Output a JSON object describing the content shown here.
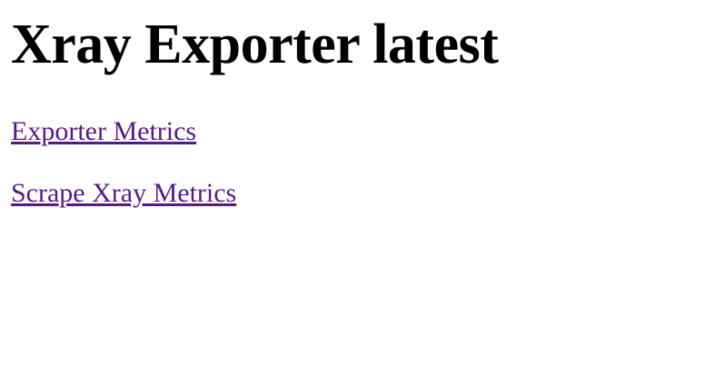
{
  "page": {
    "title": "Xray Exporter latest",
    "link_color": "#551a8b"
  },
  "links": [
    {
      "label": "Exporter Metrics"
    },
    {
      "label": "Scrape Xray Metrics"
    }
  ]
}
